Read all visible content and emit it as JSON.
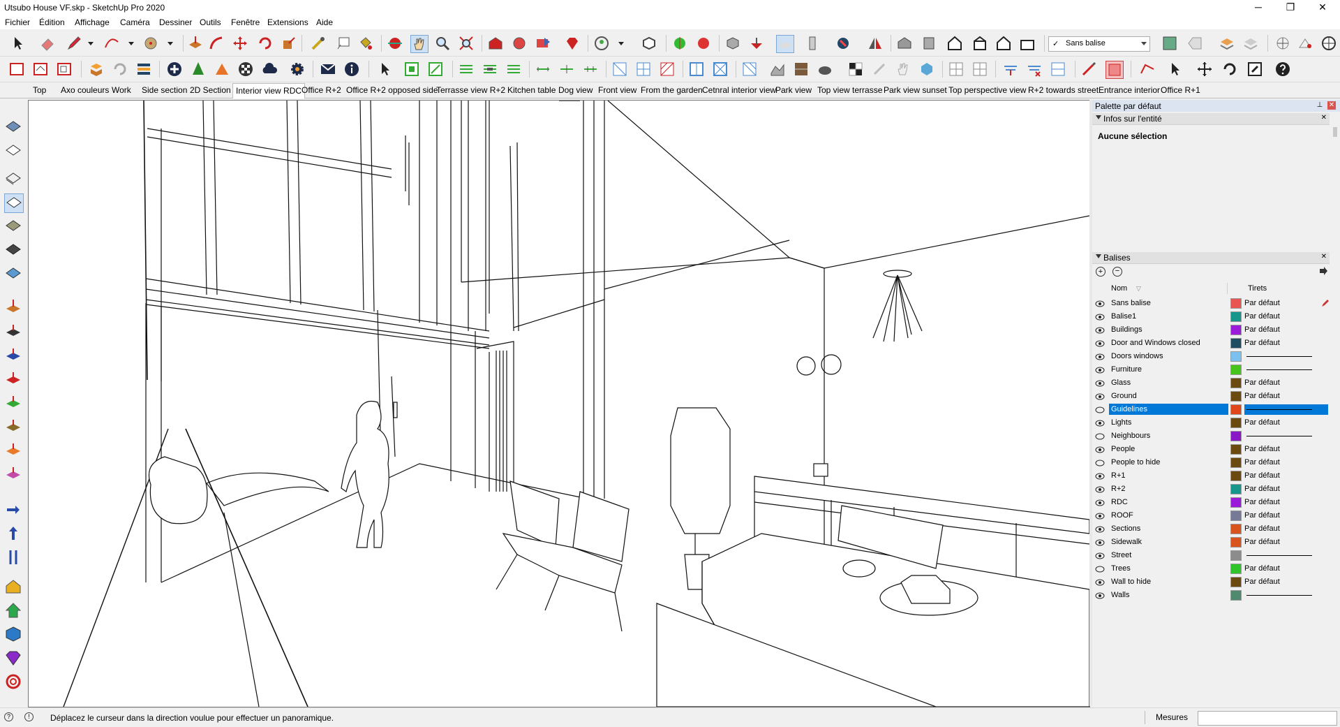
{
  "window": {
    "title": "Utsubo House VF.skp - SketchUp Pro 2020"
  },
  "window_controls": {
    "minimize": "─",
    "maximize": "❐",
    "close": "✕"
  },
  "menu": [
    "Fichier",
    "Édition",
    "Affichage",
    "Caméra",
    "Dessiner",
    "Outils",
    "Fenêtre",
    "Extensions",
    "Aide"
  ],
  "tag_dropdown": {
    "check": "✓",
    "value": "Sans balise"
  },
  "scenes": [
    "Top",
    "Axo couleurs",
    "Work",
    "Side section",
    "2D Section",
    "Interior view RDC",
    "Office R+2",
    "Office R+2 opposed side",
    "Terrasse view R+2",
    "Kitchen table",
    "Dog view",
    "Front view",
    "From the garden",
    "Cetnral interior view",
    "Park view",
    "Top view terrasse",
    "Park view sunset",
    "Top perspective view",
    "R+2 towards street",
    "Entrance interior",
    "Office R+1"
  ],
  "active_scene": "Interior view RDC",
  "panel": {
    "title": "Palette par défaut",
    "pin": "⊥",
    "close": "✕",
    "entity_info": {
      "header": "Infos sur l'entité",
      "close": "✕",
      "status": "Aucune sélection"
    },
    "tags": {
      "header": "Balises",
      "close": "✕",
      "col_name": "Nom",
      "col_dash": "Tirets",
      "rows": [
        {
          "name": "Sans balise",
          "color": "#e8544f",
          "dash": "Par défaut",
          "visible": true
        },
        {
          "name": "Balise1",
          "color": "#17968c",
          "dash": "Par défaut",
          "visible": true
        },
        {
          "name": "Buildings",
          "color": "#9a1bd8",
          "dash": "Par défaut",
          "visible": true
        },
        {
          "name": "Door and Windows closed",
          "color": "#1e4d63",
          "dash": "Par défaut",
          "visible": true
        },
        {
          "name": "Doors windows",
          "color": "#7cc1ee",
          "dash": "",
          "visible": true
        },
        {
          "name": "Furniture",
          "color": "#46c41b",
          "dash": "",
          "visible": true
        },
        {
          "name": "Glass",
          "color": "#6b4a10",
          "dash": "Par défaut",
          "visible": true
        },
        {
          "name": "Ground",
          "color": "#6b4a10",
          "dash": "Par défaut",
          "visible": true
        },
        {
          "name": "Guidelines",
          "color": "#e0481c",
          "dash": "",
          "visible": false
        },
        {
          "name": "Lights",
          "color": "#6b4a10",
          "dash": "Par défaut",
          "visible": true
        },
        {
          "name": "Neighbours",
          "color": "#8a17c6",
          "dash": "",
          "visible": false
        },
        {
          "name": "People",
          "color": "#6b4a10",
          "dash": "Par défaut",
          "visible": true
        },
        {
          "name": "People to hide",
          "color": "#6b4a10",
          "dash": "Par défaut",
          "visible": false
        },
        {
          "name": "R+1",
          "color": "#6b4a10",
          "dash": "Par défaut",
          "visible": true
        },
        {
          "name": "R+2",
          "color": "#17968c",
          "dash": "Par défaut",
          "visible": true
        },
        {
          "name": "RDC",
          "color": "#9a1bd8",
          "dash": "Par défaut",
          "visible": true
        },
        {
          "name": "ROOF",
          "color": "#777a96",
          "dash": "Par défaut",
          "visible": true
        },
        {
          "name": "Sections",
          "color": "#d9541c",
          "dash": "Par défaut",
          "visible": true
        },
        {
          "name": "Sidewalk",
          "color": "#d9541c",
          "dash": "Par défaut",
          "visible": true
        },
        {
          "name": "Street",
          "color": "#8c8c8c",
          "dash": "",
          "visible": true
        },
        {
          "name": "Trees",
          "color": "#2ec42a",
          "dash": "Par défaut",
          "visible": false
        },
        {
          "name": "Wall to hide",
          "color": "#6b4a10",
          "dash": "Par défaut",
          "visible": true
        },
        {
          "name": "Walls",
          "color": "#4f8a6e",
          "dash": "",
          "visible": true
        }
      ],
      "selected": "Guidelines"
    }
  },
  "status": {
    "message": "Déplacez le curseur dans la direction voulue pour effectuer un panoramique.",
    "measurements_label": "Mesures",
    "measurements_value": ""
  },
  "colors": {
    "selection": "#0078d7",
    "panel_title_bg": "#dbe4f0"
  }
}
